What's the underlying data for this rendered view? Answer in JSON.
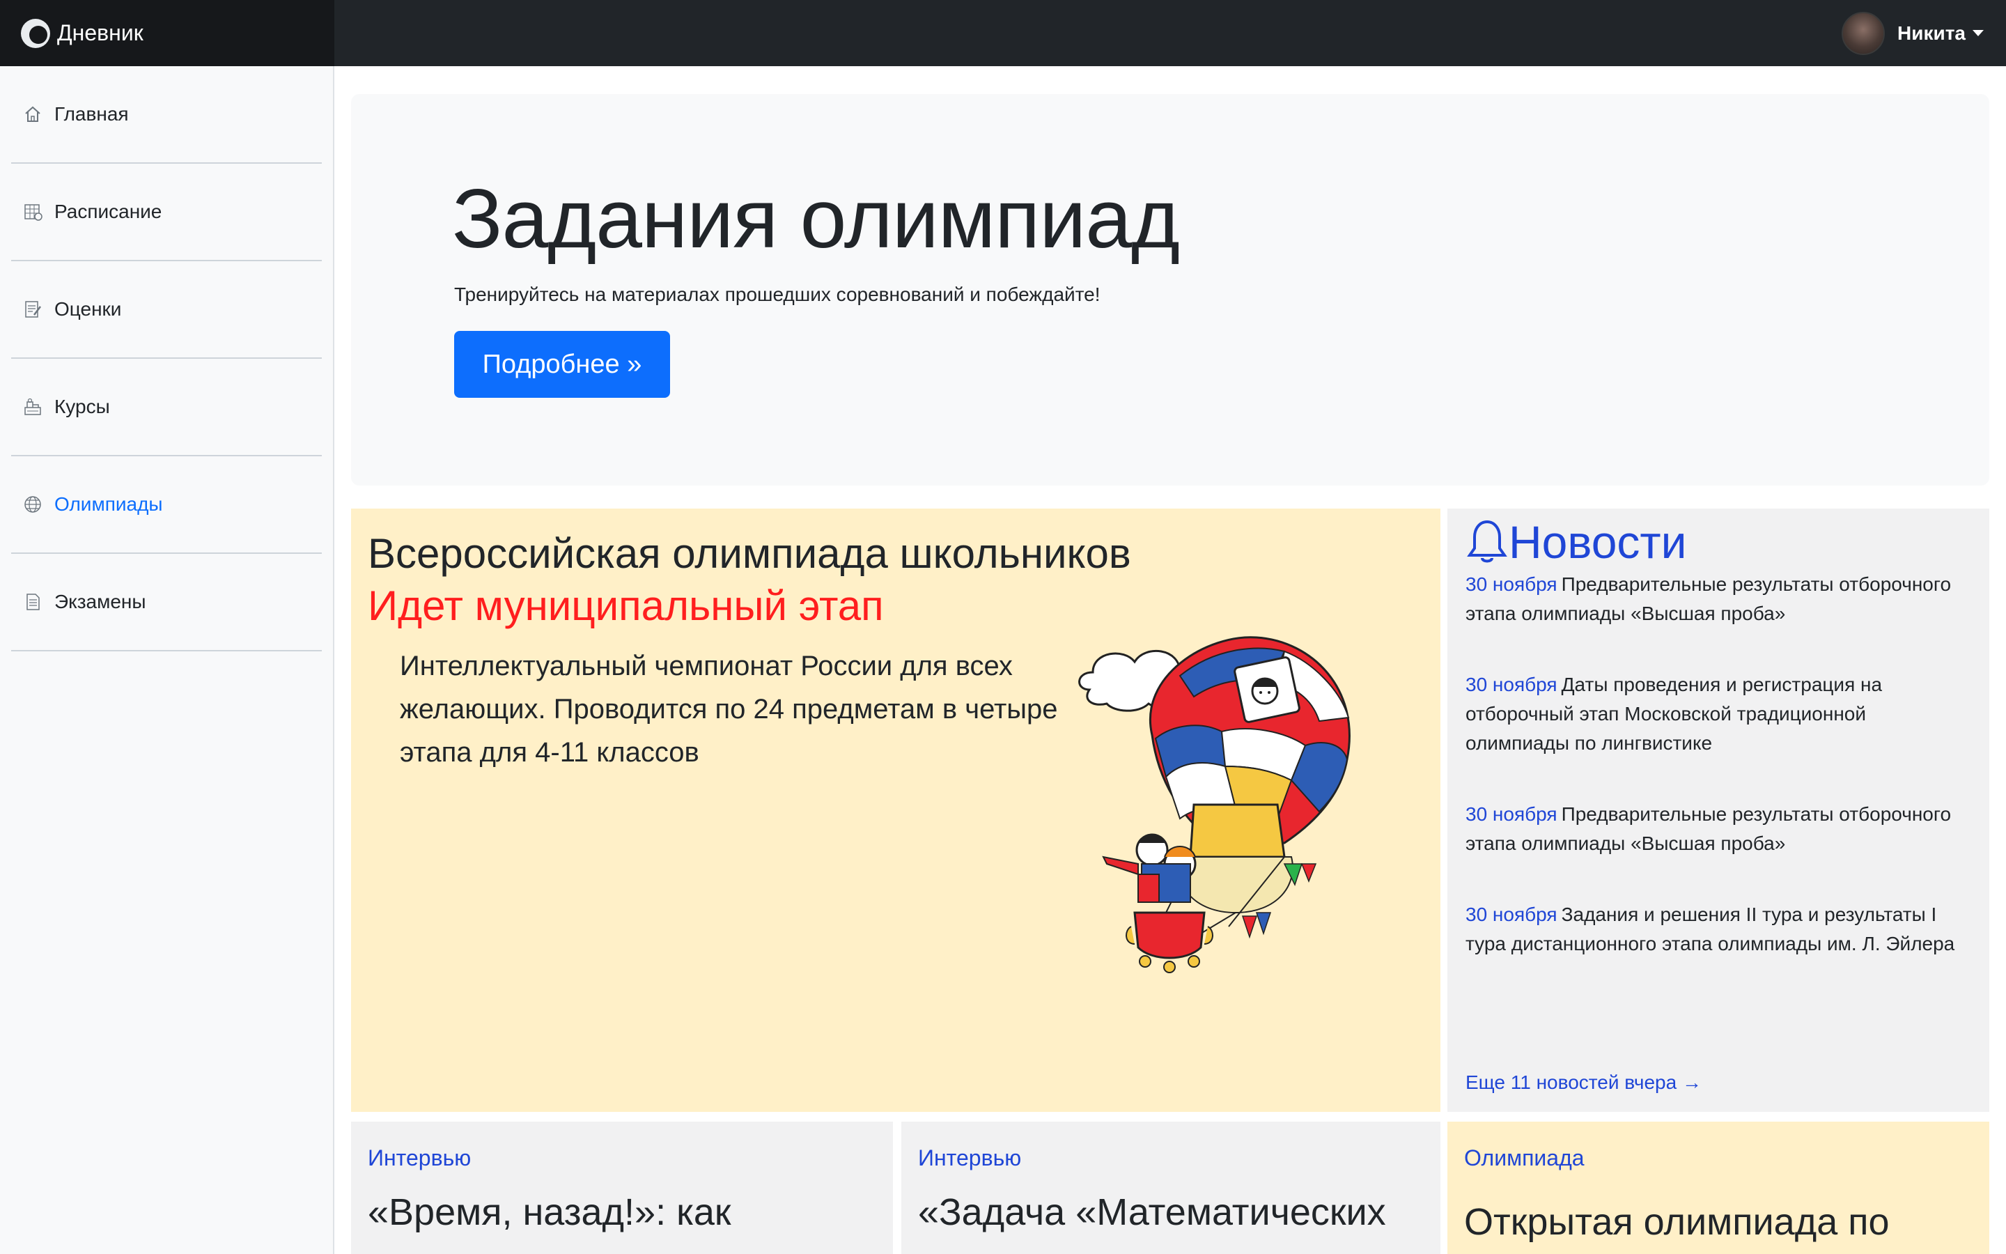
{
  "app": {
    "name": "Дневник"
  },
  "user": {
    "name": "Никита"
  },
  "sidebar": {
    "items": [
      {
        "label": "Главная",
        "icon": "home-icon",
        "active": false
      },
      {
        "label": "Расписание",
        "icon": "calendar-icon",
        "active": false
      },
      {
        "label": "Оценки",
        "icon": "grades-icon",
        "active": false
      },
      {
        "label": "Курсы",
        "icon": "courses-icon",
        "active": false
      },
      {
        "label": "Олимпиады",
        "icon": "globe-icon",
        "active": true
      },
      {
        "label": "Экзамены",
        "icon": "document-icon",
        "active": false
      }
    ]
  },
  "hero": {
    "title": "Задания олимпиад",
    "subtitle": "Тренируйтесь на материалах прошедших соревнований и побеждайте!",
    "button_label": "Подробнее »"
  },
  "feature": {
    "title": "Всероссийская олимпиада школьников",
    "subtitle": "Идет муниципальный этап",
    "text": "Интеллектуальный чемпионат России для всех желающих. Проводится по 24 предметам в четыре этапа для 4-11 классов",
    "image": "hot-air-balloon-illustration"
  },
  "news": {
    "title": "Новости",
    "icon": "bell-icon",
    "items": [
      {
        "date": "30 ноября",
        "text": "Предварительные результаты отборочного этапа олимпиады «Высшая проба»"
      },
      {
        "date": "30 ноября",
        "text": "Даты проведения и регистрация на отборочный этап Московской традиционной олимпиады по лингвистике"
      },
      {
        "date": "30 ноября",
        "text": "Предварительные результаты отборочного этапа олимпиады «Высшая проба»"
      },
      {
        "date": "30 ноября",
        "text": "Задания и решения II тура и результаты I тура дистанционного этапа олимпиады им. Л. Эйлера"
      }
    ],
    "more_label": "Еще 11 новостей вчера →"
  },
  "cards": [
    {
      "category": "Интервью",
      "title": "«Время, назад!»: как"
    },
    {
      "category": "Интервью",
      "title": "«Задача «Математических"
    },
    {
      "category": "Олимпиада",
      "title": "Открытая олимпиада по"
    }
  ],
  "colors": {
    "accent": "#0d6efd",
    "link": "#1f46d6",
    "alert": "#ff1e1e",
    "feature_bg": "#fff0c8",
    "topbar": "#212529"
  }
}
